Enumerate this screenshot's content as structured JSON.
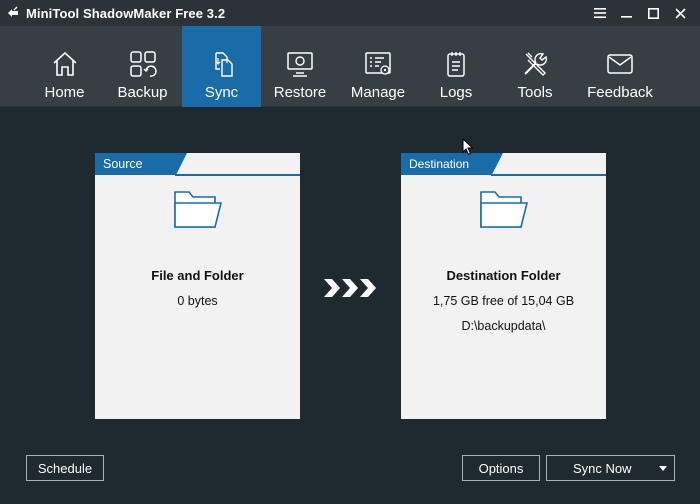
{
  "app": {
    "title": "MiniTool ShadowMaker Free 3.2"
  },
  "window_controls": {
    "menu_icon": "hamburger-icon",
    "minimize_icon": "minimize-icon",
    "maximize_icon": "maximize-icon",
    "close_icon": "close-icon"
  },
  "nav": {
    "items": [
      {
        "label": "Home",
        "icon": "home-icon"
      },
      {
        "label": "Backup",
        "icon": "backup-icon"
      },
      {
        "label": "Sync",
        "icon": "sync-icon",
        "active": true
      },
      {
        "label": "Restore",
        "icon": "restore-icon"
      },
      {
        "label": "Manage",
        "icon": "manage-icon"
      },
      {
        "label": "Logs",
        "icon": "logs-icon"
      },
      {
        "label": "Tools",
        "icon": "tools-icon"
      },
      {
        "label": "Feedback",
        "icon": "feedback-icon"
      }
    ]
  },
  "source": {
    "tab_label": "Source",
    "title": "File and Folder",
    "size": "0 bytes"
  },
  "destination": {
    "tab_label": "Destination",
    "title": "Destination Folder",
    "free_space": "1,75 GB free of 15,04 GB",
    "path": "D:\\backupdata\\"
  },
  "buttons": {
    "schedule": "Schedule",
    "options": "Options",
    "sync_now": "Sync Now"
  },
  "colors": {
    "accent": "#1a6ca8",
    "background": "#1f2a30",
    "navbar": "#363f44",
    "card": "#f2f2f2"
  }
}
